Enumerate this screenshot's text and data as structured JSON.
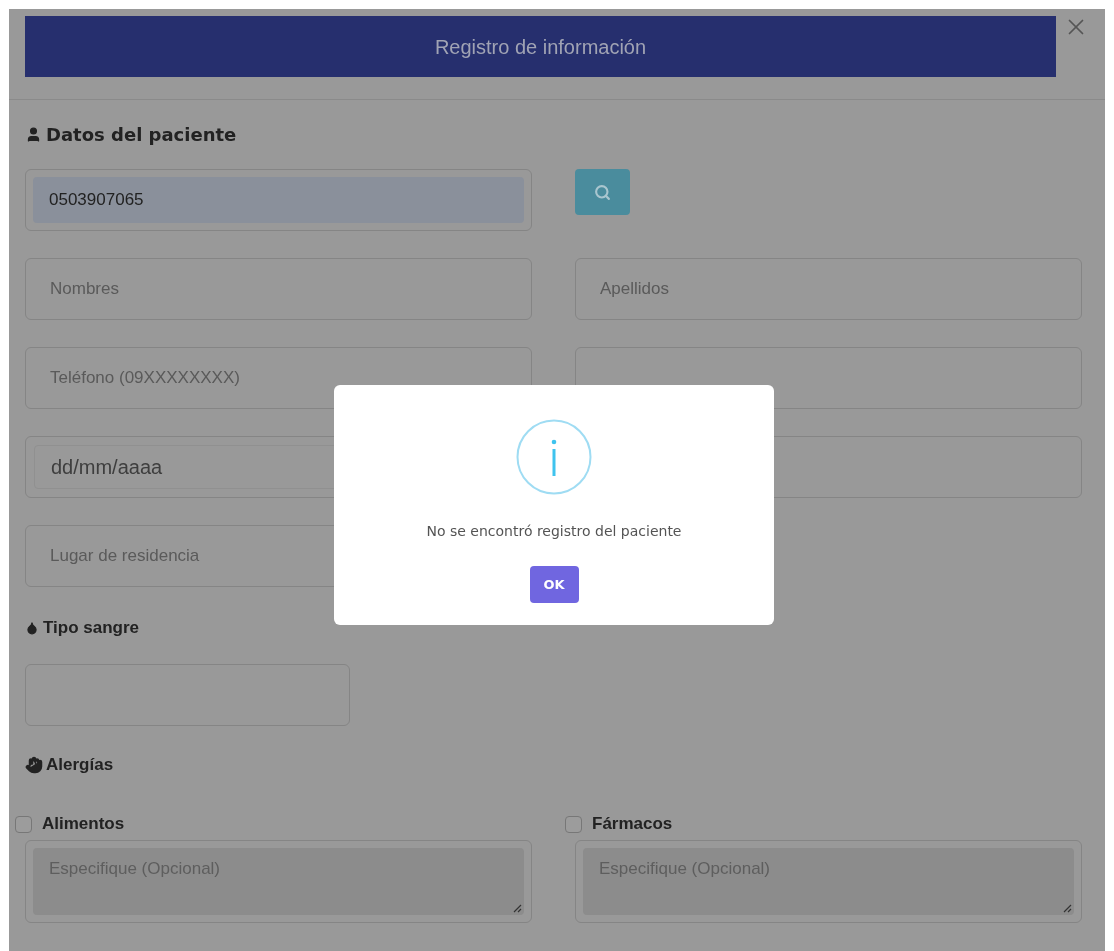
{
  "window": {
    "title": "Registro de información"
  },
  "patient": {
    "heading": "Datos del paciente",
    "id_field": {
      "value": "0503907065"
    },
    "fields": [
      {
        "kind": "text",
        "placeholder": "Nombres"
      },
      {
        "kind": "text",
        "placeholder": "Apellidos"
      },
      {
        "kind": "text",
        "placeholder": "Teléfono (09XXXXXXXX)"
      },
      {
        "kind": "text"
      },
      {
        "kind": "date",
        "value": "dd/mm/aaaa"
      },
      {
        "kind": "text"
      },
      {
        "kind": "text",
        "placeholder": "Lugar de residencia"
      }
    ]
  },
  "blood_type": {
    "heading": "Tipo sangre"
  },
  "allergies": {
    "heading": "Alergías",
    "options": [
      {
        "label": "Alimentos",
        "checked": false,
        "placeholder": "Especifique (Opcional)"
      },
      {
        "label": "Fármacos",
        "checked": false,
        "placeholder": "Especifique (Opcional)"
      }
    ]
  },
  "dialog": {
    "message": "No se encontró registro del paciente",
    "button": "OK"
  }
}
